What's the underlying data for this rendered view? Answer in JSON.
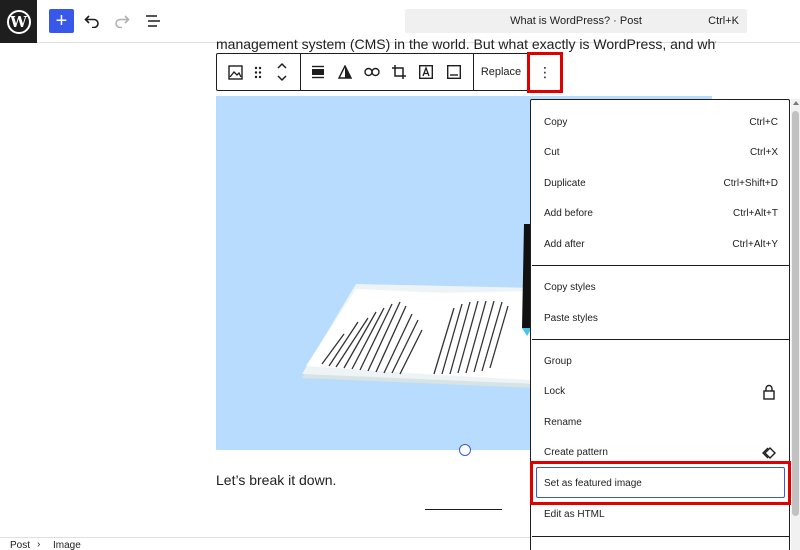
{
  "topbar": {
    "command_title": "What is WordPress? · Post",
    "command_shortcut": "Ctrl+K"
  },
  "content": {
    "paragraph_top": "management system (CMS) in the world. But what exactly is WordPress, and why",
    "paragraph_bottom": "Let’s break it down."
  },
  "block_toolbar": {
    "replace_label": "Replace",
    "more_label": "⋮"
  },
  "menu": {
    "sections": [
      [
        {
          "label": "Copy",
          "shortcut": "Ctrl+C"
        },
        {
          "label": "Cut",
          "shortcut": "Ctrl+X"
        },
        {
          "label": "Duplicate",
          "shortcut": "Ctrl+Shift+D"
        },
        {
          "label": "Add before",
          "shortcut": "Ctrl+Alt+T"
        },
        {
          "label": "Add after",
          "shortcut": "Ctrl+Alt+Y"
        }
      ],
      [
        {
          "label": "Copy styles"
        },
        {
          "label": "Paste styles"
        }
      ],
      [
        {
          "label": "Group"
        },
        {
          "label": "Lock",
          "icon": "lock-icon"
        },
        {
          "label": "Rename"
        },
        {
          "label": "Create pattern",
          "icon": "pattern-icon"
        },
        {
          "label": "Set as featured image"
        },
        {
          "label": "Edit as HTML"
        }
      ]
    ]
  },
  "breadcrumb": {
    "items": [
      "Post",
      "Image"
    ],
    "separator": "›"
  },
  "colors": {
    "accent": "#3858e9",
    "highlight": "#e10000",
    "image_background": "#b8dcfd"
  }
}
